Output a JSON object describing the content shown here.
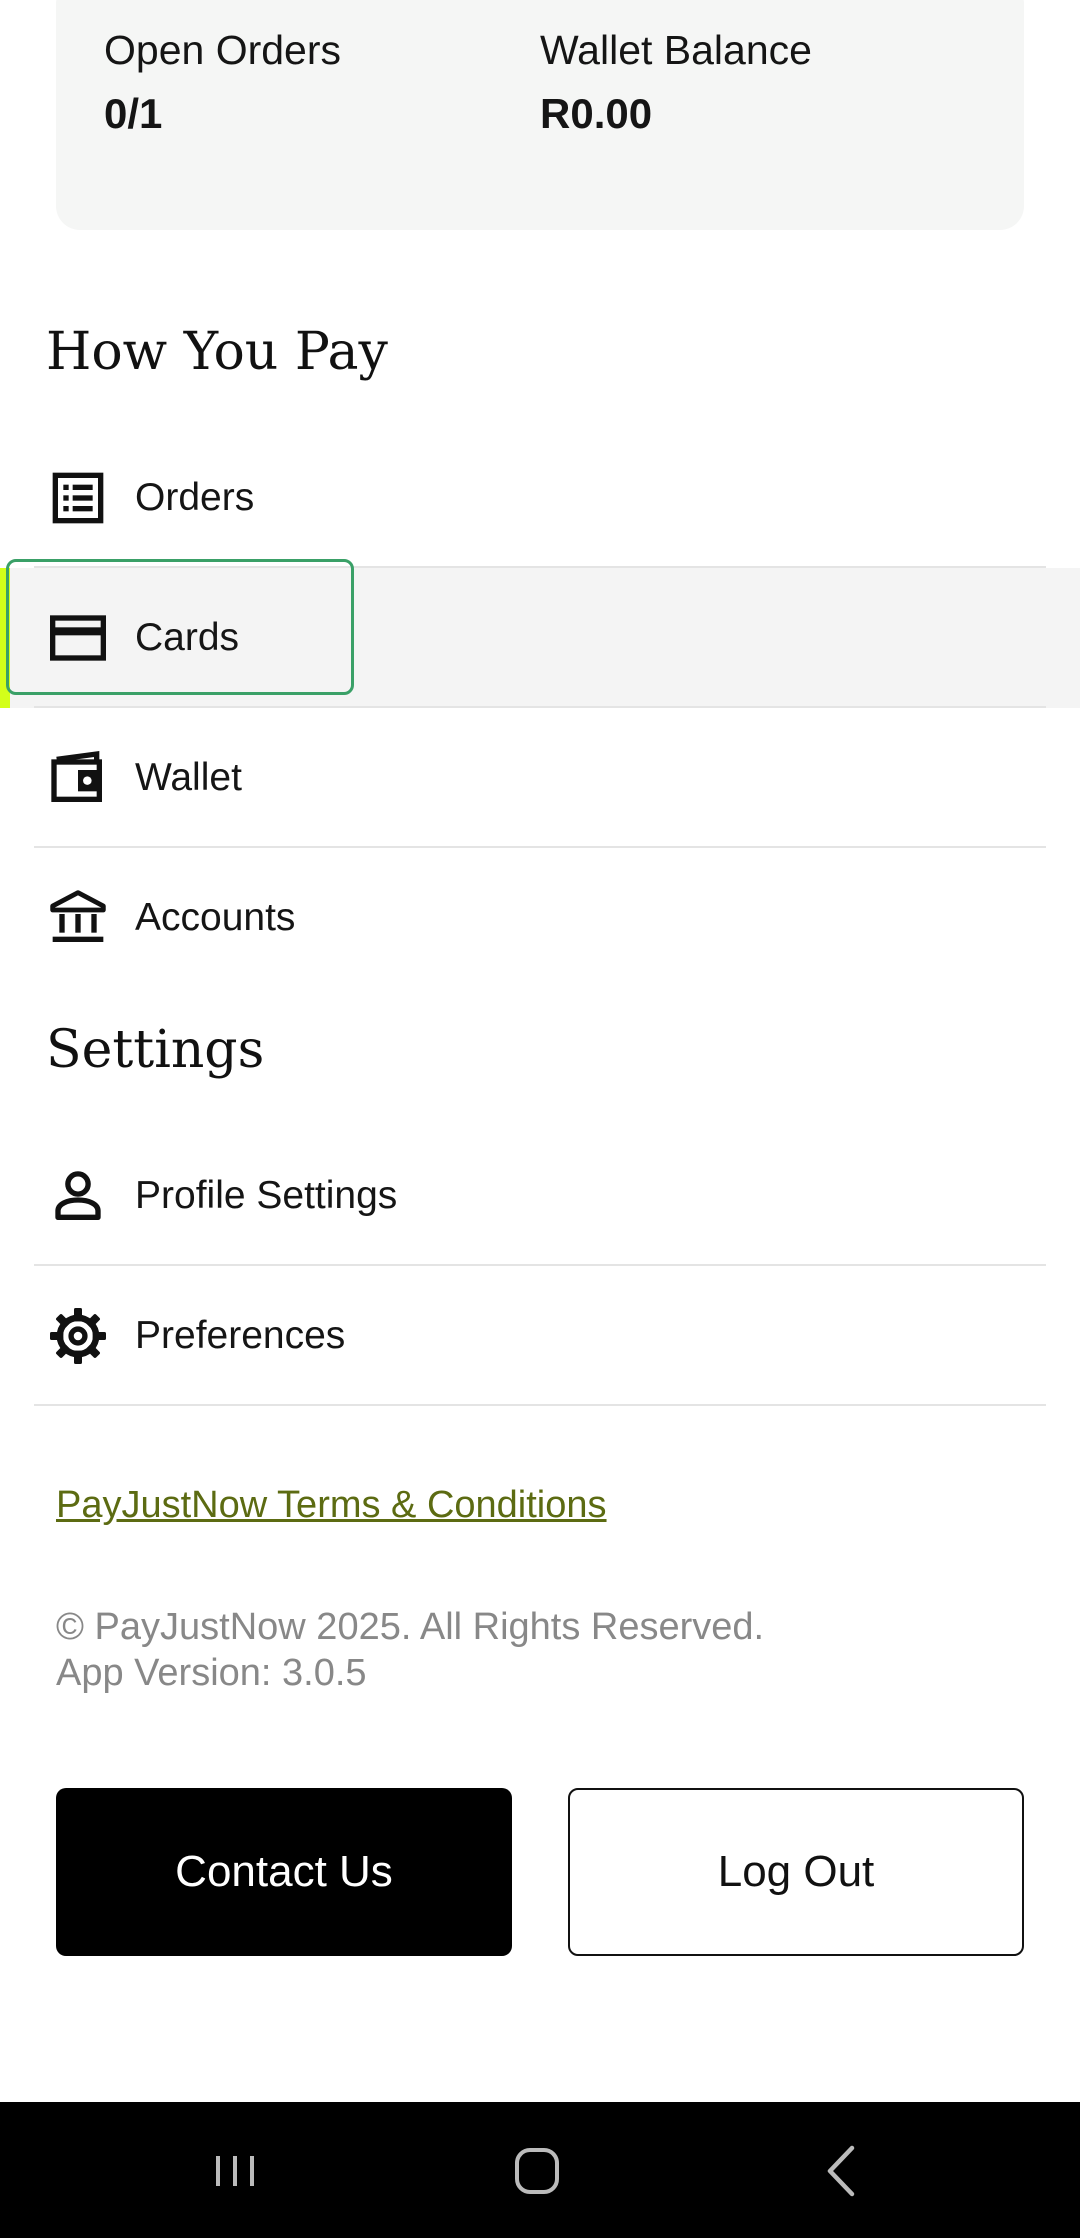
{
  "summary": {
    "open_orders_label": "Open Orders",
    "open_orders_value": "0/1",
    "wallet_balance_label": "Wallet Balance",
    "wallet_balance_value": "R0.00"
  },
  "how_you_pay": {
    "title": "How You Pay",
    "items": [
      {
        "label": "Orders",
        "icon": "list-icon"
      },
      {
        "label": "Cards",
        "icon": "credit-card-icon"
      },
      {
        "label": "Wallet",
        "icon": "wallet-icon"
      },
      {
        "label": "Accounts",
        "icon": "bank-icon"
      }
    ]
  },
  "settings": {
    "title": "Settings",
    "items": [
      {
        "label": "Profile Settings",
        "icon": "person-icon"
      },
      {
        "label": "Preferences",
        "icon": "gear-icon"
      }
    ]
  },
  "terms_link": "PayJustNow Terms & Conditions",
  "footer": {
    "copyright": "© PayJustNow 2025. All Rights Reserved.",
    "version": "App Version: 3.0.5"
  },
  "buttons": {
    "contact": "Contact Us",
    "logout": "Log Out"
  },
  "colors": {
    "accent": "#d3ff1a",
    "focus": "#3aa067",
    "link": "#5c6b12"
  }
}
